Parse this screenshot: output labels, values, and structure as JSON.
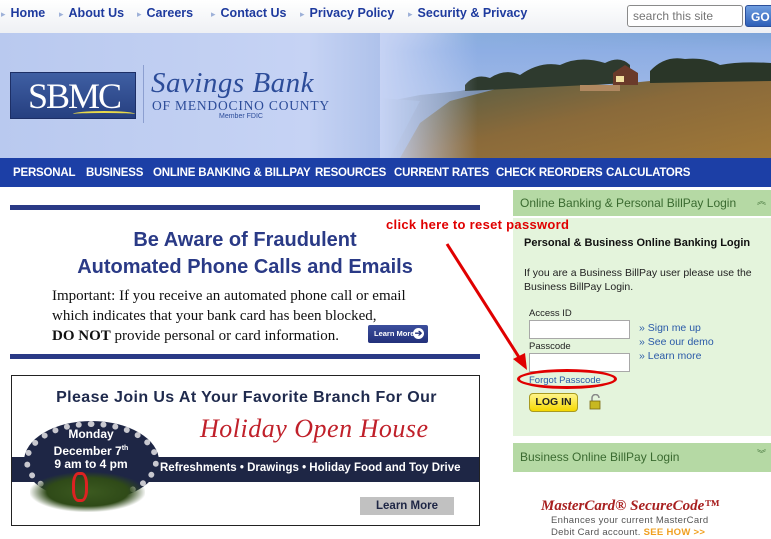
{
  "topnav": {
    "items": [
      "Home",
      "About Us",
      "Careers",
      "Contact Us",
      "Privacy Policy",
      "Security & Privacy"
    ],
    "search_placeholder": "search this site",
    "search_button": "GO"
  },
  "banner": {
    "logo": "SBMC",
    "bank_name": "Savings Bank",
    "bank_subtitle": "OF MENDOCINO COUNTY",
    "member": "Member FDIC"
  },
  "mainnav": {
    "items": [
      "PERSONAL",
      "BUSINESS",
      "ONLINE BANKING & BILLPAY",
      "RESOURCES",
      "CURRENT RATES",
      "CHECK REORDERS",
      "CALCULATORS"
    ]
  },
  "fraud_alert": {
    "headline_line1": "Be Aware of Fraudulent",
    "headline_line2": "Automated Phone Calls and Emails",
    "body_line1": "Important: If you receive an automated phone call or email",
    "body_line2": "which indicates that your bank card has been blocked,",
    "body_bold": "DO NOT",
    "body_line3": " provide personal or card information.",
    "button": "Learn More"
  },
  "holiday": {
    "heading": "Please Join Us At Your Favorite Branch For Our",
    "title": "Holiday Open House",
    "date_day": "Monday",
    "date": "December 7",
    "date_suffix": "th",
    "time": "9 am to 4 pm",
    "band": "Refreshments • Drawings • Holiday Food and Toy Drive",
    "button": "Learn More"
  },
  "annotation": {
    "text": "click here to reset password",
    "color": "#e00000"
  },
  "login_panel": {
    "header": "Online Banking & Personal BillPay Login",
    "title": "Personal & Business Online Banking Login",
    "info": "If you are a Business BillPay user please use the Business BillPay Login.",
    "access_id_label": "Access ID",
    "access_id_value": "",
    "passcode_label": "Passcode",
    "passcode_value": "",
    "links": [
      "» Sign me up",
      "» See our demo",
      "» Learn more"
    ],
    "forgot": "Forgot Passcode",
    "login_button": "LOG IN"
  },
  "business_panel": {
    "header": "Business Online BillPay Login"
  },
  "mastercard": {
    "title": "MasterCard® SecureCode™",
    "line1": "Enhances your current MasterCard",
    "line2": "Debit Card account.",
    "see_how": "SEE HOW >>"
  },
  "colors": {
    "nav_blue": "#1c3fa6",
    "panel_green": "#b5d9a4",
    "panel_bg": "#e4f4dc",
    "link_blue": "#1e3a9e"
  }
}
